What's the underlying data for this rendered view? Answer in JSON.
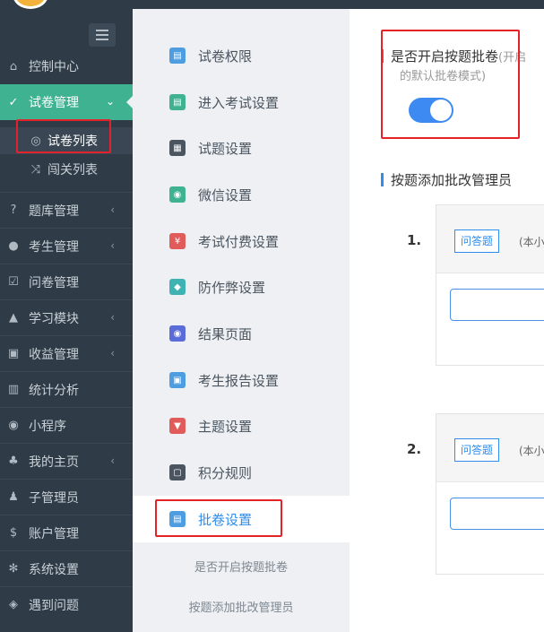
{
  "sidebar": {
    "items": [
      {
        "label": "控制中心",
        "icon": "home-icon",
        "glyph": "⌂"
      },
      {
        "label": "试卷管理",
        "icon": "check-circle-icon",
        "glyph": "✓",
        "chev": "⌄"
      },
      {
        "label": "题库管理",
        "icon": "question-circle-icon",
        "glyph": "?",
        "chev": "‹"
      },
      {
        "label": "考生管理",
        "icon": "user-icon",
        "glyph": "●",
        "chev": "‹"
      },
      {
        "label": "问卷管理",
        "icon": "checkbox-icon",
        "glyph": "☑"
      },
      {
        "label": "学习模块",
        "icon": "graduation-cap-icon",
        "glyph": "▲",
        "chev": "‹"
      },
      {
        "label": "收益管理",
        "icon": "money-icon",
        "glyph": "▣",
        "chev": "‹"
      },
      {
        "label": "统计分析",
        "icon": "bar-chart-icon",
        "glyph": "▥"
      },
      {
        "label": "小程序",
        "icon": "wechat-icon",
        "glyph": "◉"
      },
      {
        "label": "我的主页",
        "icon": "tree-icon",
        "glyph": "♣",
        "chev": "‹"
      },
      {
        "label": "子管理员",
        "icon": "user-tie-icon",
        "glyph": "♟"
      },
      {
        "label": "账户管理",
        "icon": "dollar-icon",
        "glyph": "$"
      },
      {
        "label": "系统设置",
        "icon": "gear-icon",
        "glyph": "✻"
      },
      {
        "label": "遇到问题",
        "icon": "tag-icon",
        "glyph": "◈"
      }
    ],
    "sub_items": [
      {
        "label": "试卷列表",
        "icon": "check-circle-small-icon",
        "glyph": "◎"
      },
      {
        "label": "闯关列表",
        "icon": "shuffle-icon",
        "glyph": "⤨"
      }
    ]
  },
  "submenu": {
    "items": [
      {
        "label": "试卷权限",
        "color": "#4d9de0",
        "glyph": "▤"
      },
      {
        "label": "进入考试设置",
        "color": "#3fb391",
        "glyph": "▤"
      },
      {
        "label": "试题设置",
        "color": "#4b5560",
        "glyph": "▦"
      },
      {
        "label": "微信设置",
        "color": "#3fb391",
        "glyph": "◉"
      },
      {
        "label": "考试付费设置",
        "color": "#e25b5b",
        "glyph": "¥"
      },
      {
        "label": "防作弊设置",
        "color": "#3fb3b3",
        "glyph": "◆"
      },
      {
        "label": "结果页面",
        "color": "#5a6cd8",
        "glyph": "◉"
      },
      {
        "label": "考生报告设置",
        "color": "#4d9de0",
        "glyph": "▣"
      },
      {
        "label": "主题设置",
        "color": "#e25b5b",
        "glyph": "▼"
      },
      {
        "label": "积分规则",
        "color": "#4b5560",
        "glyph": "▢"
      },
      {
        "label": "批卷设置",
        "color": "#4d9de0",
        "glyph": "▤"
      }
    ],
    "sub_links": [
      "是否开启按题批卷",
      "按题添加批改管理员"
    ]
  },
  "main": {
    "section1_title": "是否开启按题批卷",
    "section1_hint": "(开启",
    "section1_hint2": "的默认批卷模式)",
    "toggle_on": true,
    "section2_title": "按题添加批改管理员",
    "questions": [
      {
        "num": "1.",
        "tag": "问答题",
        "score": "(本小"
      },
      {
        "num": "2.",
        "tag": "问答题",
        "score": "(本小"
      }
    ]
  },
  "colors": {
    "sidebar_bg": "#2f3b47",
    "accent_green": "#3fb391",
    "accent_blue": "#2e8ded",
    "highlight_red": "#e2232a"
  }
}
